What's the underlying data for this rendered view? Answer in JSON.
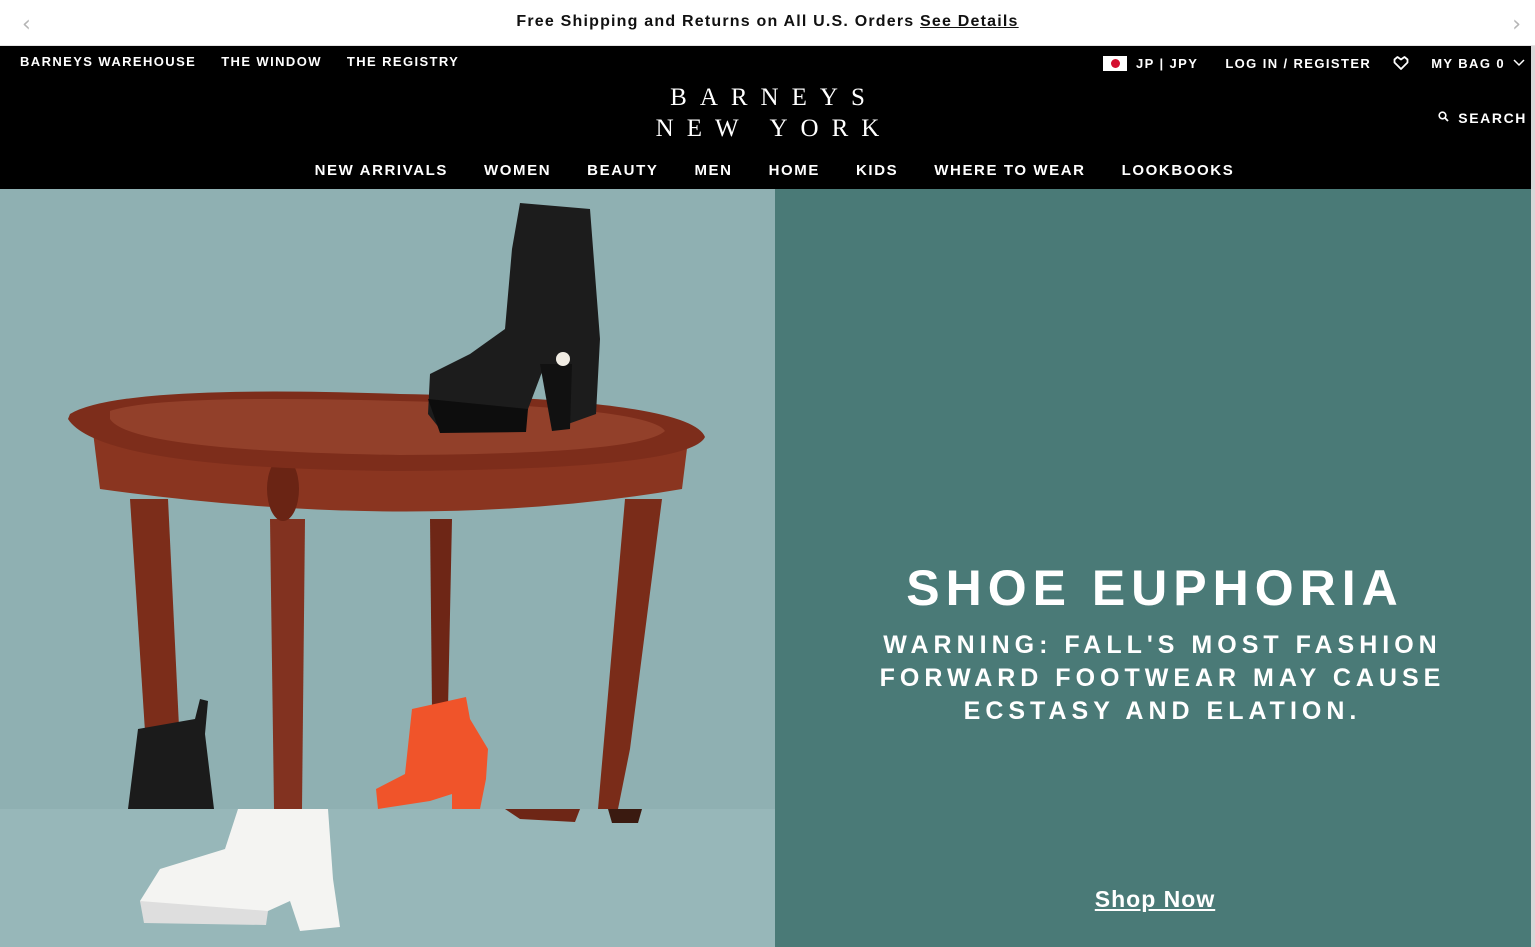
{
  "promo": {
    "text": "Free Shipping and Returns on All U.S. Orders",
    "link": "See Details",
    "prev_icon": "chevron-left-icon",
    "next_icon": "chevron-right-icon"
  },
  "utility_nav": {
    "left": [
      "BARNEYS WAREHOUSE",
      "THE WINDOW",
      "THE REGISTRY"
    ],
    "locale": "JP | JPY",
    "login": "LOG IN / REGISTER",
    "wishlist_icon": "heart-icon",
    "bag": "MY BAG 0"
  },
  "logo": {
    "line1": "BARNEYS",
    "line2": "NEW YORK"
  },
  "search": {
    "label": "SEARCH",
    "icon": "search-icon"
  },
  "main_nav": [
    "NEW ARRIVALS",
    "WOMEN",
    "BEAUTY",
    "MEN",
    "HOME",
    "KIDS",
    "WHERE TO WEAR",
    "LOOKBOOKS"
  ],
  "hero": {
    "title": "SHOE EUPHORIA",
    "subtitle": "WARNING: FALL'S MOST FASHION FORWARD FOOTWEAR MAY CAUSE ECSTASY AND ELATION.",
    "cta": "Shop Now"
  },
  "colors": {
    "header_bg": "#000000",
    "hero_left_bg": "#8fb0b2",
    "hero_right_bg": "#4a7a77",
    "flag_red": "#d40f2f",
    "boot_orange": "#f0542a",
    "table_wood": "#7a2e1c"
  }
}
